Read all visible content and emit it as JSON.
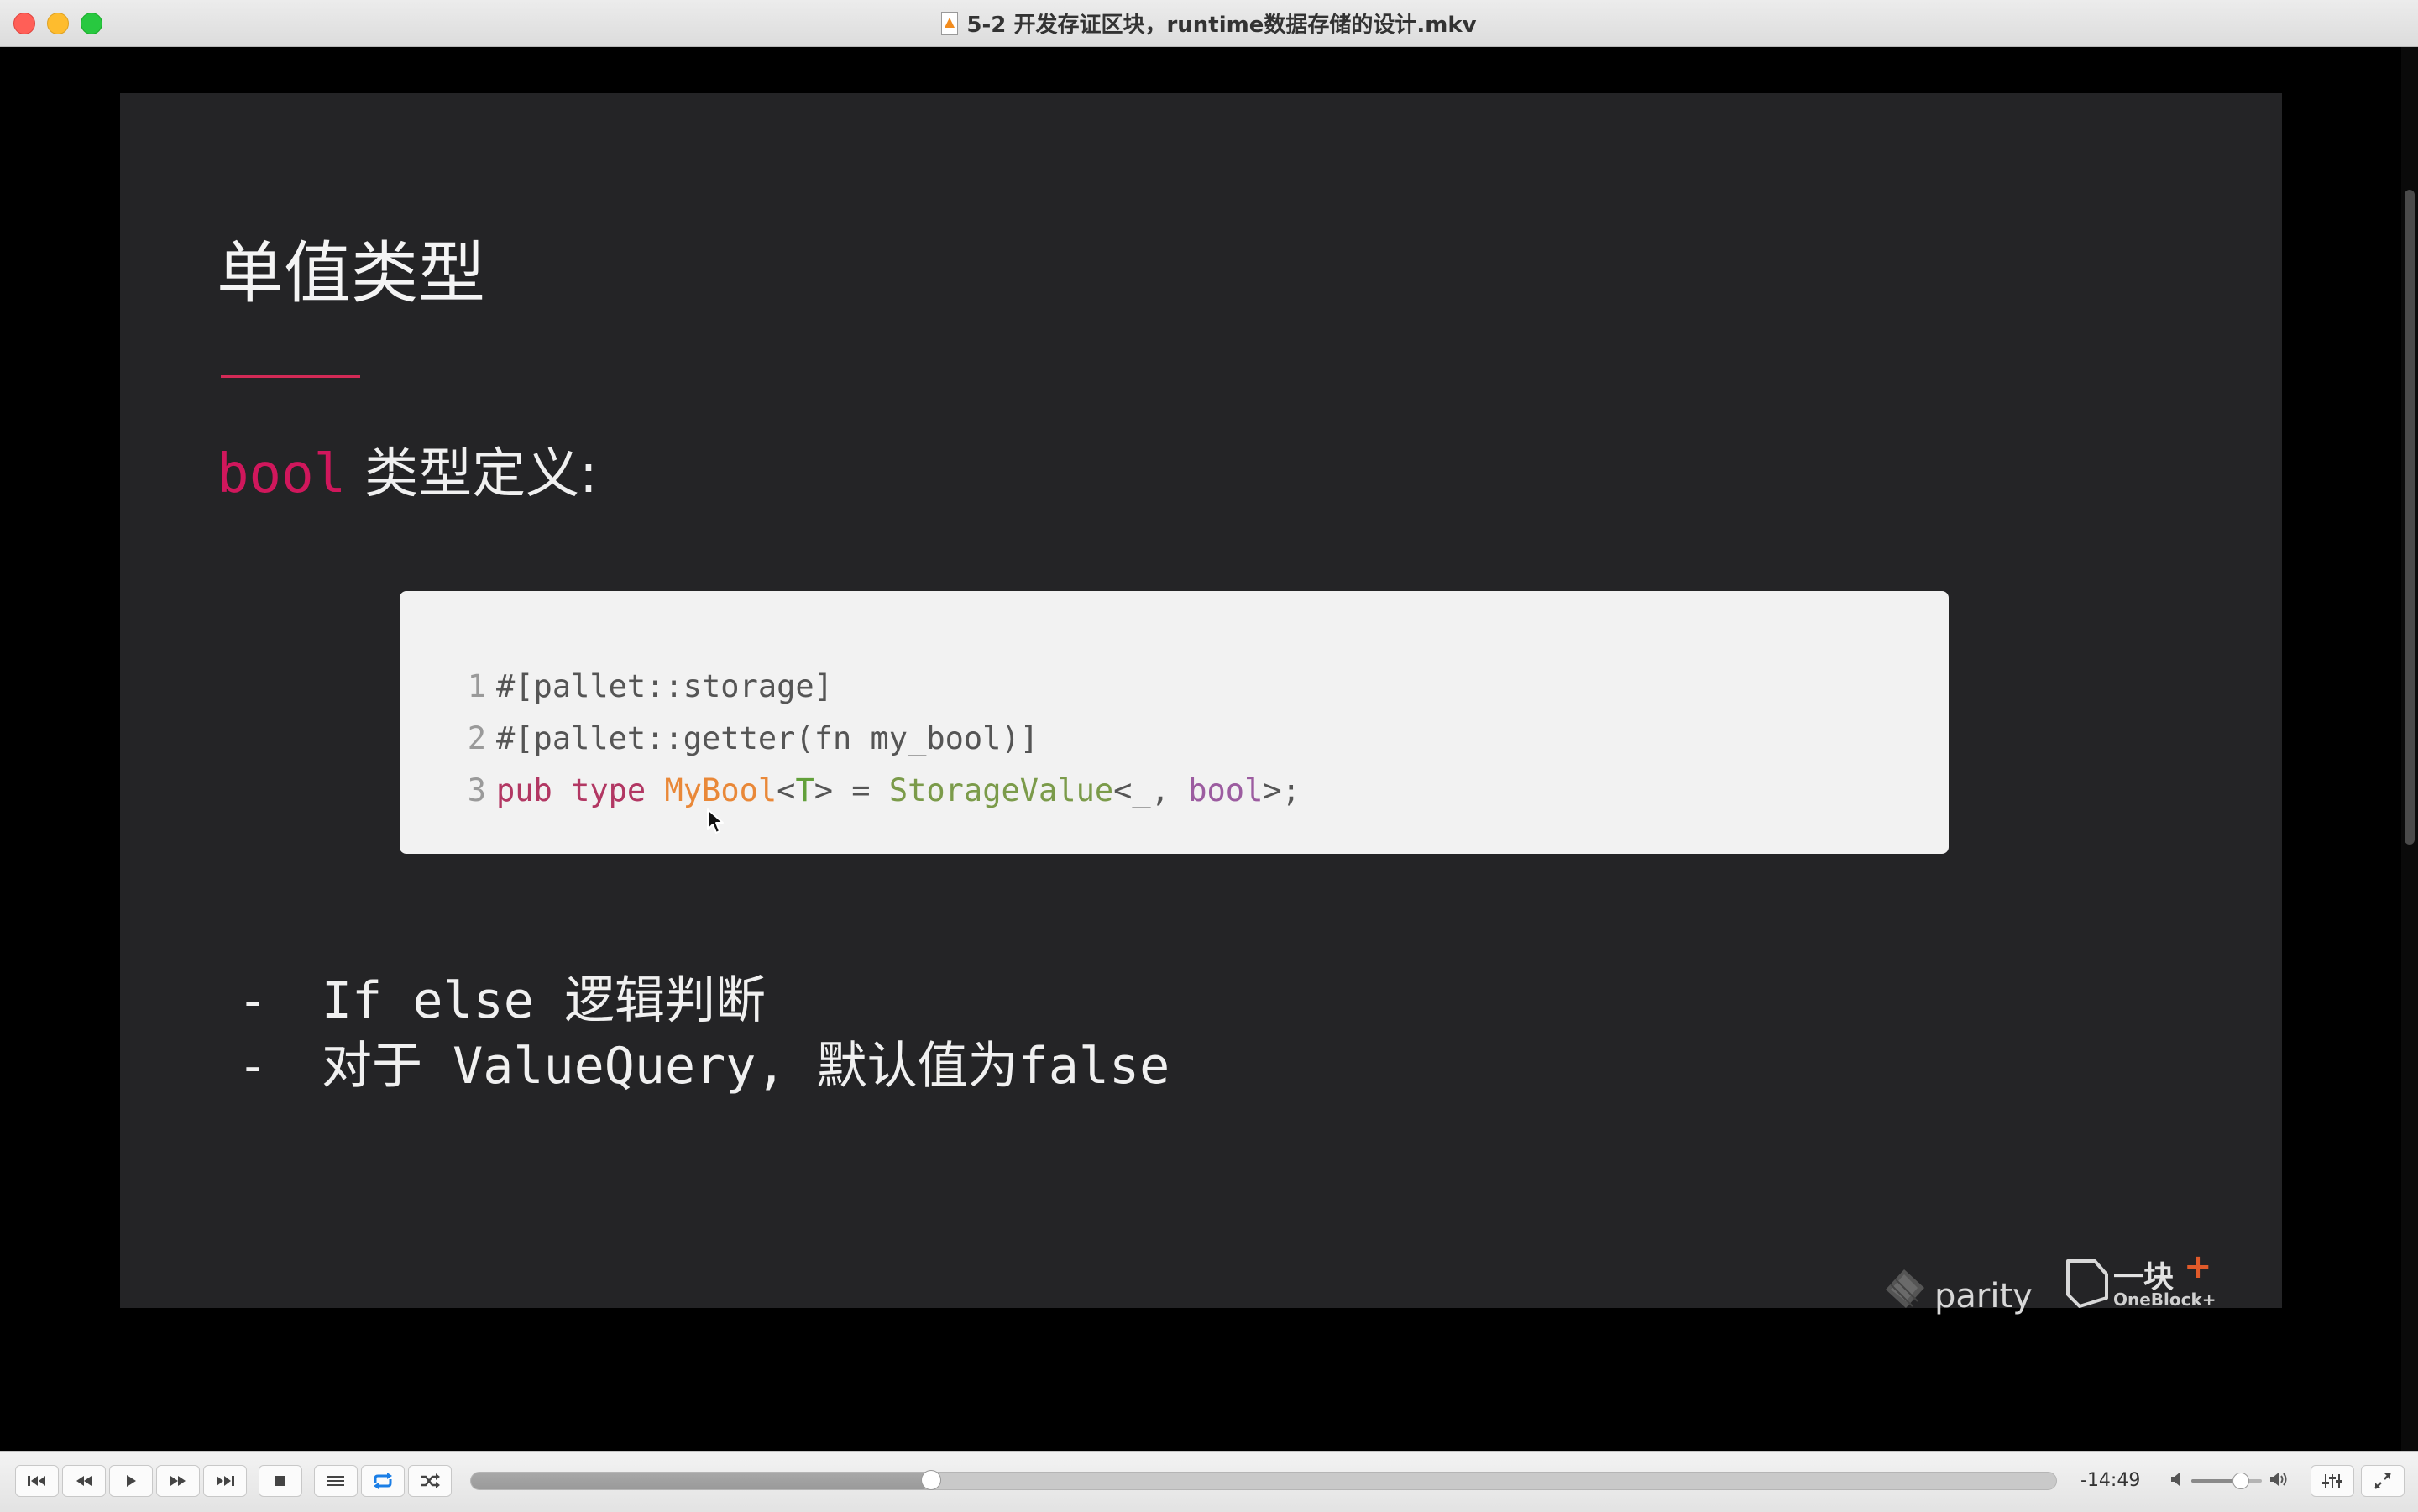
{
  "window": {
    "title": "5-2 开发存证区块，runtime数据存储的设计.mkv",
    "file_icon": "vlc-file-icon"
  },
  "slide": {
    "title": "单值类型",
    "subtitle_code": "bool",
    "subtitle_text": "类型定义:",
    "code_lines": [
      {
        "number": "1",
        "text": "#[pallet::storage]"
      },
      {
        "number": "2",
        "text": "#[pallet::getter(fn my_bool)]"
      },
      {
        "number": "3",
        "parts": [
          "pub",
          " ",
          "type",
          " ",
          "MyBool",
          "<",
          "T",
          "> = ",
          "StorageValue",
          "<_, ",
          "bool",
          ">;"
        ]
      }
    ],
    "bullets": [
      {
        "dash": "-",
        "text": "If else 逻辑判断"
      },
      {
        "dash": "-",
        "text": "对于 ValueQuery, 默认值为false"
      }
    ],
    "logos": {
      "parity": "parity",
      "oneblock_main": "一块",
      "oneblock_plus": "+",
      "oneblock_sub": "OneBlock+"
    },
    "colors": {
      "background": "#242426",
      "accent": "#d0175c",
      "code_bg": "#f2f2f2"
    }
  },
  "controls": {
    "buttons": [
      "previous-icon",
      "rewind-icon",
      "play-icon",
      "fast-forward-icon",
      "next-icon",
      "stop-icon",
      "playlist-icon",
      "loop-icon",
      "shuffle-icon"
    ],
    "progress_fraction": 0.29,
    "time_remaining": "-14:49",
    "volume_fraction": 0.7
  }
}
